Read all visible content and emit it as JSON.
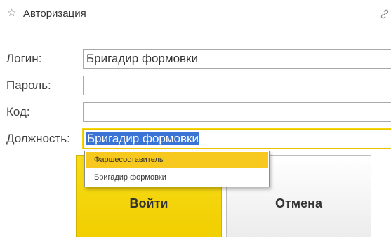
{
  "window": {
    "title": "Авторизация",
    "star_icon": "star-icon",
    "link_icon": "link-icon"
  },
  "form": {
    "login_label": "Логин:",
    "login_value": "Бригадир формовки",
    "password_label": "Пароль:",
    "password_value": "",
    "code_label": "Код:",
    "code_value": "",
    "position_label": "Должность:",
    "position_value": "Бригадир формовки"
  },
  "dropdown": {
    "items": [
      {
        "label": "Фаршесоставитель",
        "highlighted": true
      },
      {
        "label": "Бригадир формовки",
        "highlighted": false
      }
    ]
  },
  "buttons": {
    "login_label": "Войти",
    "cancel_label": "Отмена"
  },
  "colors": {
    "accent_yellow": "#f1cf00",
    "highlight_yellow": "#f7c81d",
    "selection_blue": "#3a75d6",
    "border_gray": "#a9a9a9"
  }
}
